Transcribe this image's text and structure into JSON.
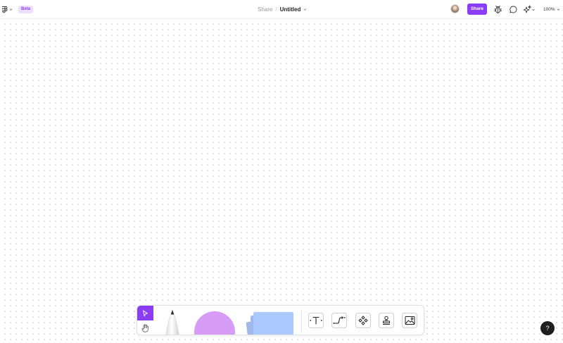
{
  "topbar": {
    "beta_label": "Beta",
    "breadcrumb": {
      "share": "Share",
      "separator": "/",
      "title": "Untitled"
    },
    "share_button": "Share",
    "zoom_level": "100%"
  },
  "toolbar": {
    "tools": [
      "select",
      "hand",
      "pen",
      "shape",
      "sticky-note",
      "text",
      "connector",
      "component",
      "stamp",
      "image"
    ]
  },
  "help": {
    "label": "?"
  },
  "colors": {
    "accent": "#8b3df6",
    "beta_bg": "#ede0ff",
    "shape_fill": "#d79cf6",
    "sticky_fill": "#a9c7ff",
    "canvas_dot": "#d6d6d6"
  }
}
